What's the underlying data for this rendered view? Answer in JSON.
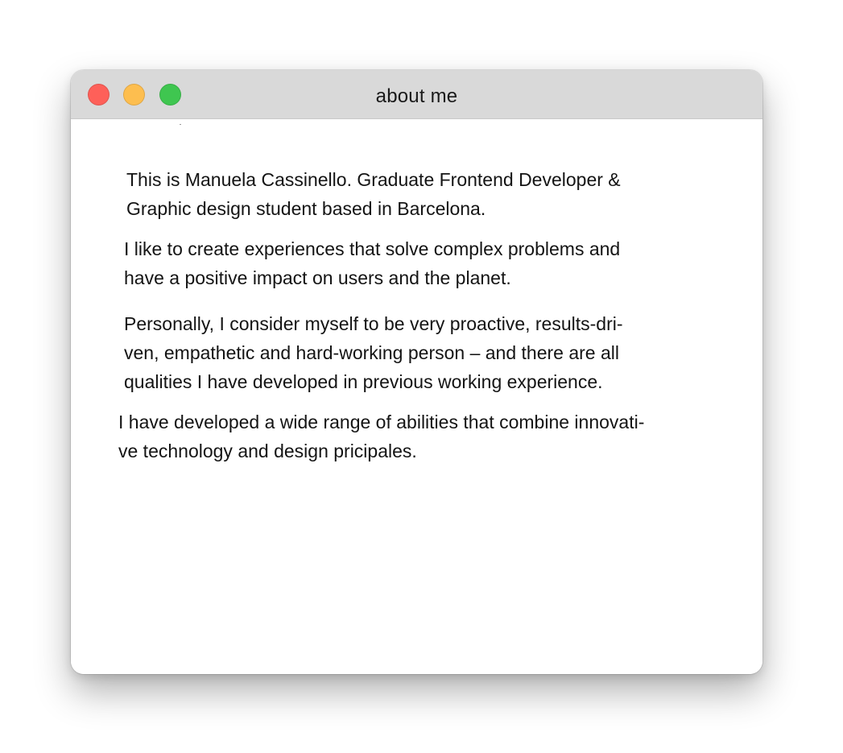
{
  "window": {
    "title": "about me",
    "controls": {
      "close_color": "#fe6059",
      "minimize_color": "#fdbe4f",
      "zoom_color": "#3fc650"
    }
  },
  "about": {
    "paragraphs": [
      "This is Manuela Cassinello. Graduate Frontend Developer &\nGraphic design student based in Barcelona.",
      "I like to create experiences that solve complex problems and\nhave a positive impact on users and the planet.",
      "Personally, I consider myself to be very proactive, results-dri-\nven, empathetic and hard-working person – and there are all\nqualities I have developed in previous working experience.",
      "I have developed a wide range of abilities that combine innovati-\nve technology and design pricipales."
    ]
  }
}
